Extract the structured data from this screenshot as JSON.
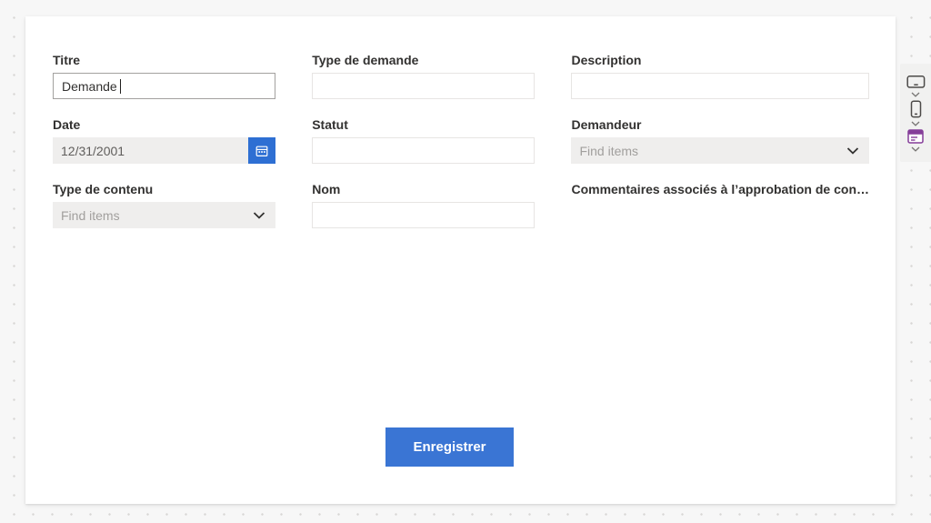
{
  "form": {
    "fields": [
      {
        "label": "Titre",
        "type": "text-active",
        "value": "Demande"
      },
      {
        "label": "Type de demande",
        "type": "text",
        "value": ""
      },
      {
        "label": "Description",
        "type": "text",
        "value": ""
      },
      {
        "label": "Date",
        "type": "date",
        "value": "12/31/2001"
      },
      {
        "label": "Statut",
        "type": "text",
        "value": ""
      },
      {
        "label": "Demandeur",
        "type": "lookup",
        "placeholder": "Find items"
      },
      {
        "label": "Type de contenu",
        "type": "lookup",
        "placeholder": "Find items"
      },
      {
        "label": "Nom",
        "type": "text",
        "value": ""
      },
      {
        "label": "Commentaires associés à l’approbation de con…",
        "type": "label-only"
      }
    ],
    "save_label": "Enregistrer"
  },
  "sidebar": {
    "items": [
      {
        "name": "desktop-preview"
      },
      {
        "name": "mobile-preview"
      },
      {
        "name": "form-preview"
      }
    ]
  },
  "colors": {
    "save_button_blue": "#3a75d4",
    "calendar_button_blue": "#2e6fd3",
    "form_icon_purple": "#853e99",
    "card_background": "#ffffff",
    "canvas_background": "#f7f7f7",
    "filled_field_gray": "#efeeed"
  }
}
